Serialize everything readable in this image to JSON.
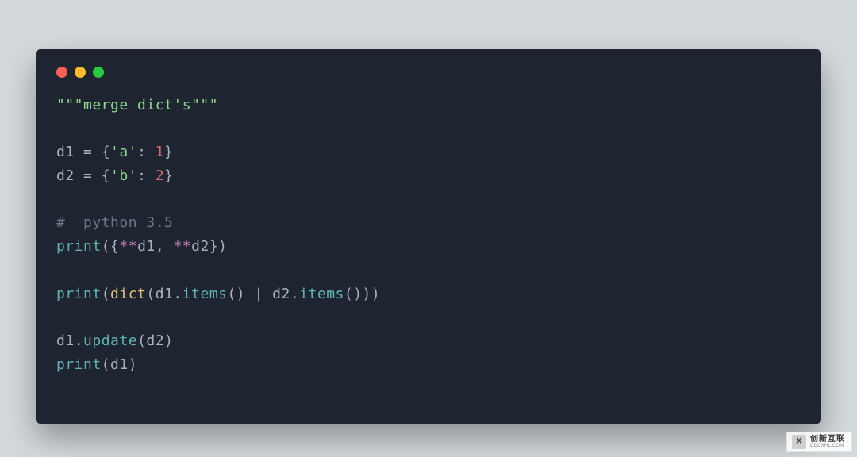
{
  "code": {
    "docstring": "\"\"\"merge dict's\"\"\"",
    "assign1_lhs": "d1 ",
    "assign1_eq": "= ",
    "assign1_open": "{",
    "assign1_key": "'a'",
    "assign1_colon": ": ",
    "assign1_val": "1",
    "assign1_close": "}",
    "assign2_lhs": "d2 ",
    "assign2_eq": "= ",
    "assign2_open": "{",
    "assign2_key": "'b'",
    "assign2_colon": ": ",
    "assign2_val": "2",
    "assign2_close": "}",
    "comment": "#  python 3.5",
    "p1_print": "print",
    "p1_open": "({",
    "p1_star1": "**",
    "p1_d1": "d1",
    "p1_comma": ", ",
    "p1_star2": "**",
    "p1_d2": "d2",
    "p1_close": "})",
    "p2_print": "print",
    "p2_open": "(",
    "p2_dict": "dict",
    "p2_open2": "(",
    "p2_d1": "d1",
    "p2_dot1": ".",
    "p2_items1": "items",
    "p2_paren1": "() ",
    "p2_pipe": "| ",
    "p2_d2": "d2",
    "p2_dot2": ".",
    "p2_items2": "items",
    "p2_paren2": "()))",
    "u1_d1": "d1",
    "u1_dot": ".",
    "u1_update": "update",
    "u1_open": "(",
    "u1_d2": "d2",
    "u1_close": ")",
    "p3_print": "print",
    "p3_open": "(",
    "p3_d1": "d1",
    "p3_close": ")"
  },
  "watermark": {
    "logo_letter": "X",
    "line1": "创新互联",
    "line2": "CDCXHL.COM"
  }
}
